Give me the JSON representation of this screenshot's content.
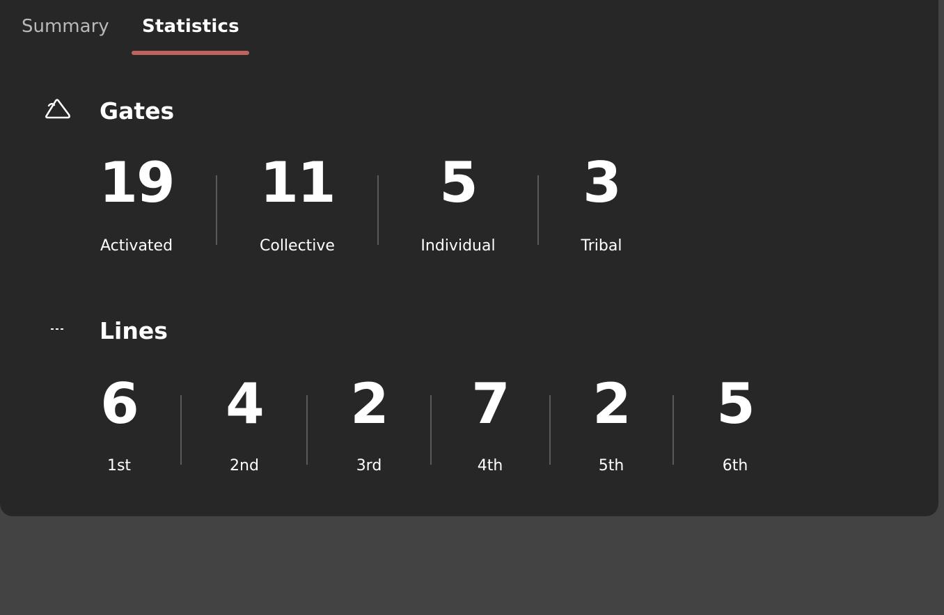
{
  "tabs": [
    {
      "label": "Summary",
      "active": false
    },
    {
      "label": "Statistics",
      "active": true
    }
  ],
  "accent_color": "#c0625f",
  "gates": {
    "title": "Gates",
    "icon": "gates-triangle-icon",
    "stats": [
      {
        "value": "19",
        "label": "Activated"
      },
      {
        "value": "11",
        "label": "Collective"
      },
      {
        "value": "5",
        "label": "Individual"
      },
      {
        "value": "3",
        "label": "Tribal"
      }
    ]
  },
  "lines": {
    "title": "Lines",
    "icon": "lines-dashes-icon",
    "stats": [
      {
        "value": "6",
        "label": "1st"
      },
      {
        "value": "4",
        "label": "2nd"
      },
      {
        "value": "2",
        "label": "3rd"
      },
      {
        "value": "7",
        "label": "4th"
      },
      {
        "value": "2",
        "label": "5th"
      },
      {
        "value": "5",
        "label": "6th"
      }
    ]
  }
}
